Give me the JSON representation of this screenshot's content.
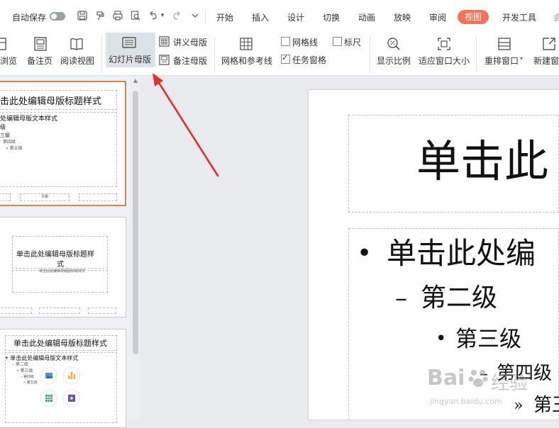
{
  "quick_access": {
    "autosave_label": "自动保存"
  },
  "menu": {
    "tabs": [
      "开始",
      "插入",
      "设计",
      "切换",
      "动画",
      "放映",
      "审阅",
      "视图",
      "开发工具"
    ],
    "active_tab": "视图"
  },
  "ribbon": {
    "normal_view_partial": "浏览",
    "notes_page": "备注页",
    "reading_view": "阅读视图",
    "slide_master": "幻灯片母版",
    "handout_master": "讲义母版",
    "notes_master": "备注母版",
    "grid_guides": "网格和参考线",
    "gridlines": "网格线",
    "gridlines_checked": false,
    "ruler": "标尺",
    "ruler_checked": false,
    "task_pane": "任务窗格",
    "task_pane_checked": true,
    "zoom": "显示比例",
    "fit_window": "适应窗口大小",
    "arrange_window": "重排窗口",
    "new_window": "新建窗口"
  },
  "thumbnails": {
    "thumb1": {
      "title": "击此处编辑母版标题样式",
      "body_l1": "处编辑母版文本样式",
      "body_l2": "级",
      "body_l3": "三级",
      "body_l4": "第四级",
      "body_l5": "» 第五级",
      "footer": "页脚"
    },
    "thumb2": {
      "title_line1": "单击此处编辑母版标题样",
      "title_line2": "式",
      "subtitle": "单击此处编辑母版副标题样式"
    },
    "thumb3": {
      "title": "单击此处编辑母版标题样式",
      "body_l1": "• 单击此处编辑母版文本样式",
      "body_l2": "– 第二级",
      "body_l3": "• 第三级",
      "body_l4": "– 第四级",
      "body_l5": "» 第五级"
    }
  },
  "slide": {
    "title": "单击此",
    "level1": "单击此处编",
    "level2": "第二级",
    "level3": "第三级",
    "level4": "第四级",
    "level5": "第王"
  },
  "watermark": {
    "brand": "Bai",
    "brand2": "经验",
    "url": "jingyan.baidu.com"
  },
  "colors": {
    "accent": "#f2745a",
    "selected_border": "#d9844f",
    "arrow": "#e0312f"
  }
}
